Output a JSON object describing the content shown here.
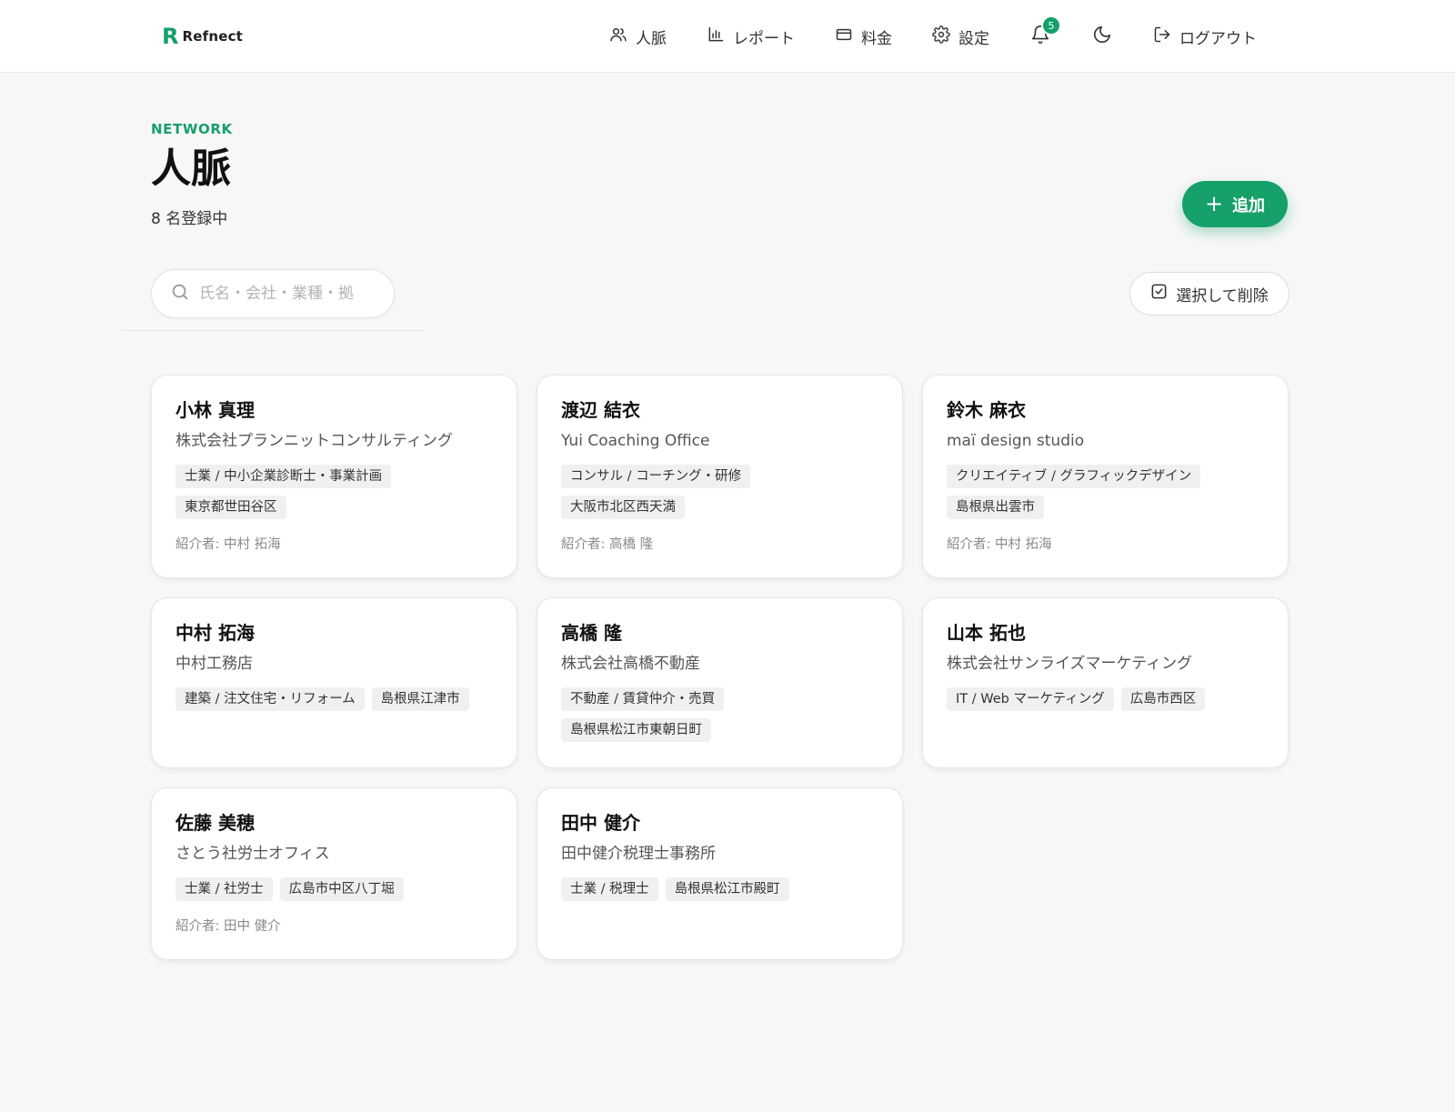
{
  "header": {
    "logo_mark": "R",
    "logo_text": "Refnect",
    "nav": [
      {
        "label": "人脈",
        "icon": "users-icon"
      },
      {
        "label": "レポート",
        "icon": "bar-chart-icon"
      },
      {
        "label": "料金",
        "icon": "credit-card-icon"
      },
      {
        "label": "設定",
        "icon": "gear-icon"
      }
    ],
    "notification_count": "5",
    "logout_label": "ログアウト"
  },
  "page": {
    "eyebrow": "NETWORK",
    "title": "人脈",
    "subtitle": "8 名登録中",
    "add_label": "追加",
    "search_placeholder": "氏名・会社・業種・拠",
    "select_delete_label": "選択して削除"
  },
  "contacts": [
    {
      "name": "小林 真理",
      "company": "株式会社プランニットコンサルティング",
      "tags": [
        "士業 / 中小企業診断士・事業計画",
        "東京都世田谷区"
      ],
      "referrer": "紹介者: 中村 拓海"
    },
    {
      "name": "渡辺 結衣",
      "company": "Yui Coaching Office",
      "tags": [
        "コンサル / コーチング・研修",
        "大阪市北区西天満"
      ],
      "referrer": "紹介者: 高橋 隆"
    },
    {
      "name": "鈴木 麻衣",
      "company": "maï design studio",
      "tags": [
        "クリエイティブ / グラフィックデザイン",
        "島根県出雲市"
      ],
      "referrer": "紹介者: 中村 拓海"
    },
    {
      "name": "中村 拓海",
      "company": "中村工務店",
      "tags": [
        "建築 / 注文住宅・リフォーム",
        "島根県江津市"
      ],
      "referrer": ""
    },
    {
      "name": "高橋 隆",
      "company": "株式会社高橋不動産",
      "tags": [
        "不動産 / 賃貸仲介・売買",
        "島根県松江市東朝日町"
      ],
      "referrer": ""
    },
    {
      "name": "山本 拓也",
      "company": "株式会社サンライズマーケティング",
      "tags": [
        "IT / Web マーケティング",
        "広島市西区"
      ],
      "referrer": ""
    },
    {
      "name": "佐藤 美穂",
      "company": "さとう社労士オフィス",
      "tags": [
        "士業 / 社労士",
        "広島市中区八丁堀"
      ],
      "referrer": "紹介者: 田中 健介"
    },
    {
      "name": "田中 健介",
      "company": "田中健介税理士事務所",
      "tags": [
        "士業 / 税理士",
        "島根県松江市殿町"
      ],
      "referrer": ""
    }
  ]
}
